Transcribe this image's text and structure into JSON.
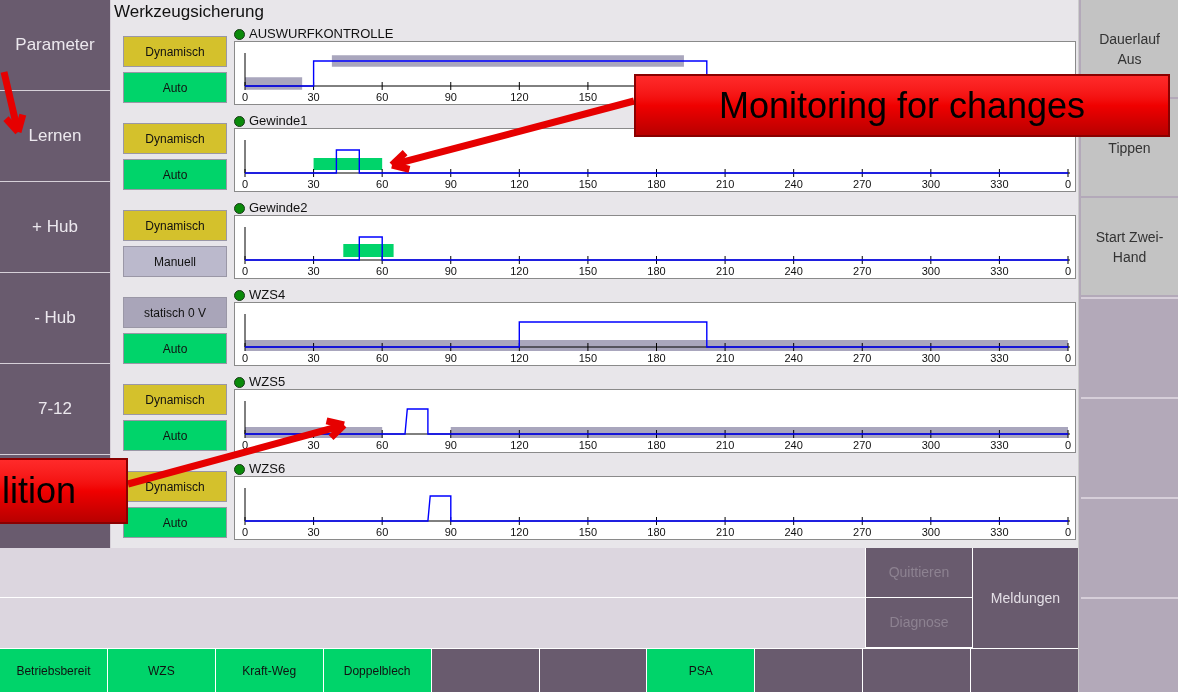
{
  "title": "Werkzeugsicherung",
  "nav": [
    {
      "label": "Parameter"
    },
    {
      "label": "Lernen"
    },
    {
      "label": "+ Hub"
    },
    {
      "label": "- Hub"
    },
    {
      "label": "7-12"
    }
  ],
  "channels": [
    {
      "name": "AUSWURFKONTROLLE",
      "led_on": true,
      "modes": [
        {
          "label": "Dynamisch",
          "kind": "dynamic"
        },
        {
          "label": "Auto",
          "kind": "auto"
        }
      ],
      "axis_labels": [
        "0",
        "30",
        "60",
        "90",
        "120",
        "150"
      ]
    },
    {
      "name": "Gewinde1",
      "led_on": true,
      "modes": [
        {
          "label": "Dynamisch",
          "kind": "dynamic"
        },
        {
          "label": "Auto",
          "kind": "auto"
        }
      ],
      "axis_labels": [
        "0",
        "30",
        "60",
        "90",
        "120",
        "150",
        "180",
        "210",
        "240",
        "270",
        "300",
        "330",
        "0"
      ]
    },
    {
      "name": "Gewinde2",
      "led_on": true,
      "modes": [
        {
          "label": "Dynamisch",
          "kind": "dynamic"
        },
        {
          "label": "Manuell",
          "kind": "manual"
        }
      ],
      "axis_labels": [
        "0",
        "30",
        "60",
        "90",
        "120",
        "150",
        "180",
        "210",
        "240",
        "270",
        "300",
        "330",
        "0"
      ]
    },
    {
      "name": "WZS4",
      "led_on": true,
      "modes": [
        {
          "label": "statisch 0 V",
          "kind": "static"
        },
        {
          "label": "Auto",
          "kind": "auto"
        }
      ],
      "axis_labels": [
        "0",
        "30",
        "60",
        "90",
        "120",
        "150",
        "180",
        "210",
        "240",
        "270",
        "300",
        "330",
        "0"
      ]
    },
    {
      "name": "WZS5",
      "led_on": true,
      "modes": [
        {
          "label": "Dynamisch",
          "kind": "dynamic"
        },
        {
          "label": "Auto",
          "kind": "auto"
        }
      ],
      "axis_labels": [
        "0",
        "30",
        "60",
        "90",
        "120",
        "150",
        "180",
        "210",
        "240",
        "270",
        "300",
        "330",
        "0"
      ]
    },
    {
      "name": "WZS6",
      "led_on": true,
      "modes": [
        {
          "label": "Dynamisch",
          "kind": "dynamic"
        },
        {
          "label": "Auto",
          "kind": "auto"
        }
      ],
      "axis_labels": [
        "0",
        "30",
        "60",
        "90",
        "120",
        "150",
        "180",
        "210",
        "240",
        "270",
        "300",
        "330",
        "0"
      ]
    }
  ],
  "side_buttons": [
    {
      "label": "Dauerlauf Aus"
    },
    {
      "label": "Tippen"
    },
    {
      "label": "Start Zwei-Hand"
    }
  ],
  "message_buttons": [
    {
      "label": "Quittieren",
      "disabled": true
    },
    {
      "label": "Diagnose",
      "disabled": true
    },
    {
      "label": "Meldungen",
      "disabled": false
    }
  ],
  "status_bar": [
    {
      "label": "Betriebsbereit",
      "active": true
    },
    {
      "label": "WZS",
      "active": true
    },
    {
      "label": "Kraft-Weg",
      "active": true
    },
    {
      "label": "Doppelblech",
      "active": true
    },
    {
      "active": false
    },
    {
      "active": false
    },
    {
      "label": "PSA",
      "active": true
    },
    {
      "active": false
    },
    {
      "active": false
    },
    {
      "active": false
    }
  ],
  "callouts": [
    {
      "text": "Monitoring for changes"
    },
    {
      "text": "lition"
    }
  ]
}
